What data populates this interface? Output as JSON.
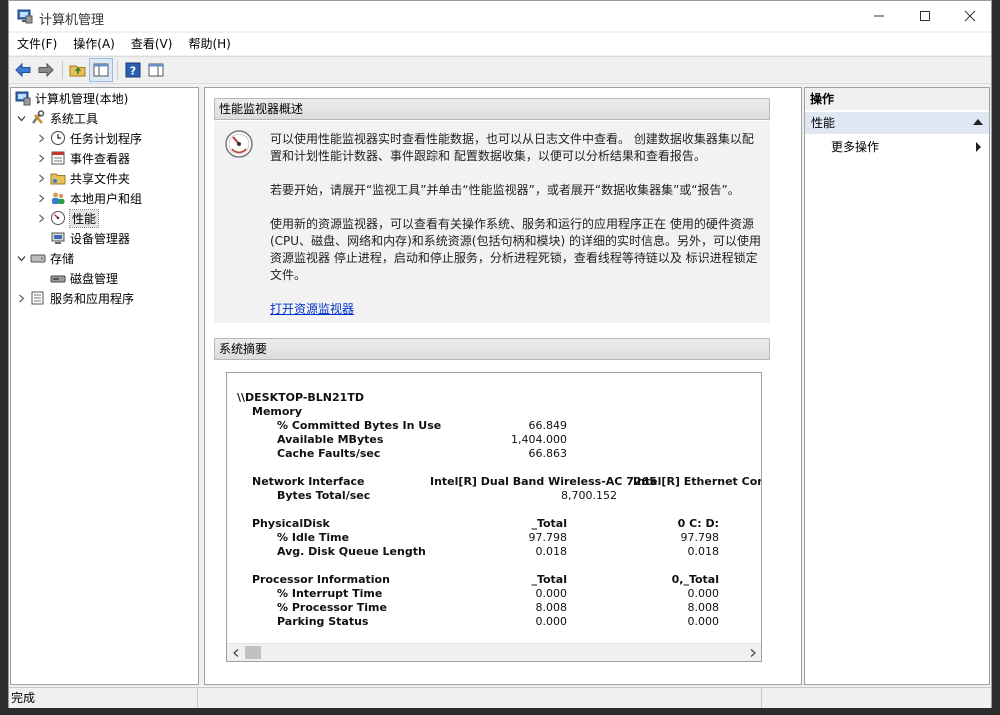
{
  "window": {
    "title": "计算机管理"
  },
  "menu": [
    "文件(F)",
    "操作(A)",
    "查看(V)",
    "帮助(H)"
  ],
  "toolbar": {
    "buttons": [
      "back-icon",
      "forward-icon",
      "up-folder-icon",
      "show-tree-icon",
      "help-icon",
      "show-action-pane-icon"
    ]
  },
  "tree": {
    "root": "计算机管理(本地)",
    "system_tools": "系统工具",
    "task_scheduler": "任务计划程序",
    "event_viewer": "事件查看器",
    "shared_folders": "共享文件夹",
    "local_users": "本地用户和组",
    "performance": "性能",
    "device_manager": "设备管理器",
    "storage": "存储",
    "disk_management": "磁盘管理",
    "services_apps": "服务和应用程序"
  },
  "overview": {
    "header": "性能监视器概述",
    "p1_line1": "可以使用性能监视器实时查看性能数据，也可以从日志文件中查看。 创建数据收集器集以配",
    "p1_line2": "置和计划性能计数器、事件跟踪和 配置数据收集，以便可以分析结果和查看报告。",
    "p2": "若要开始，请展开“监视工具”并单击“性能监视器”，或者展开“数据收集器集”或“报告”。",
    "p3_line1": "使用新的资源监视器，可以查看有关操作系统、服务和运行的应用程序正在 使用的硬件资源",
    "p3_line2": "(CPU、磁盘、网络和内存)和系统资源(包括句柄和模块) 的详细的实时信息。另外，可以使用",
    "p3_line3": "资源监视器 停止进程，启动和停止服务，分析进程死锁，查看线程等待链以及 标识进程锁定",
    "p3_line4": "文件。",
    "link": "打开资源监视器"
  },
  "summary": {
    "header": "系统摘要",
    "machine": "\\\\DESKTOP-BLN21TD",
    "memory": {
      "label": "Memory",
      "committed_label": "% Committed Bytes In Use",
      "committed_value": "66.849",
      "available_label": "Available MBytes",
      "available_value": "1,404.000",
      "cache_label": "Cache Faults/sec",
      "cache_value": "66.863"
    },
    "network": {
      "label": "Network Interface",
      "col1": "Intel[R] Dual Band Wireless-AC 7265",
      "col2": "Intel[R] Ethernet Connec",
      "bytes_label": "Bytes Total/sec",
      "bytes_value": "8,700.152"
    },
    "disk": {
      "label": "PhysicalDisk",
      "col1": "_Total",
      "col2": "0 C: D:",
      "idle_label": "% Idle Time",
      "idle_v1": "97.798",
      "idle_v2": "97.798",
      "queue_label": "Avg. Disk Queue Length",
      "queue_v1": "0.018",
      "queue_v2": "0.018"
    },
    "processor": {
      "label": "Processor Information",
      "col1": "_Total",
      "col2": "0,_Total",
      "interrupt_label": "% Interrupt Time",
      "interrupt_v1": "0.000",
      "interrupt_v2": "0.000",
      "proc_label": "% Processor Time",
      "proc_v1": "8.008",
      "proc_v2": "8.008",
      "parking_label": "Parking Status",
      "parking_v1": "0.000",
      "parking_v2": "0.000"
    }
  },
  "actions": {
    "title": "操作",
    "group": "性能",
    "more": "更多操作"
  },
  "status": {
    "text": "完成"
  },
  "colors": {
    "link": "#0033cc",
    "action_group_bg": "#dfe7f2"
  }
}
